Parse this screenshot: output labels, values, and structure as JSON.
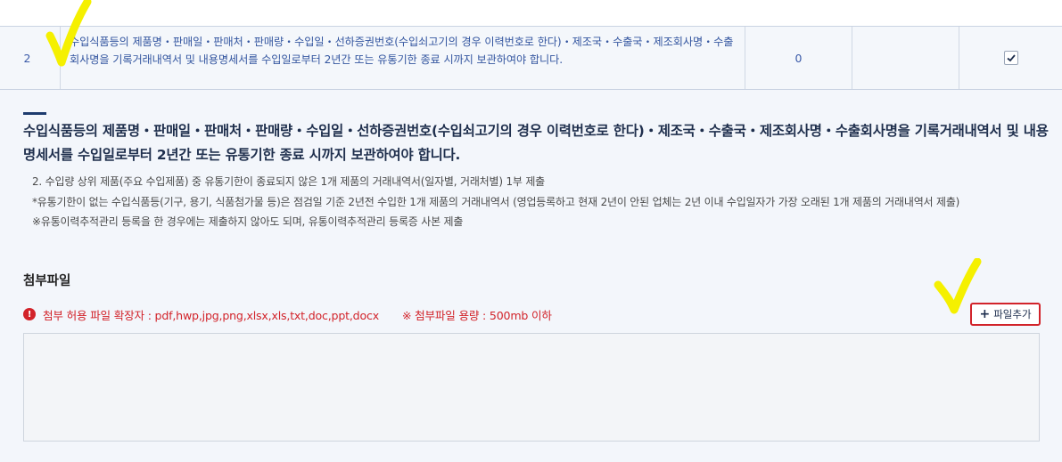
{
  "row": {
    "number": "2",
    "text": "수입식품등의 제품명・판매일・판매처・판매량・수입일・선하증권번호(수입쇠고기의 경우 이력번호로 한다)・제조국・수출국・제조회사명・수출회사명을 기록거래내역서 및 내용명세서를 수입일로부터 2년간 또는 유통기한 종료 시까지 보관하여야 합니다.",
    "count": "0",
    "checked": true
  },
  "detail": {
    "title": "수입식품등의 제품명・판매일・판매처・판매량・수입일・선하증권번호(수입쇠고기의 경우 이력번호로 한다)・제조국・수출국・제조회사명・수출회사명을 기록거래내역서 및 내용명세서를 수입일로부터 2년간 또는 유통기한 종료 시까지 보관하여야 합니다.",
    "notes": [
      "2. 수입량 상위 제품(주요 수입제품) 중 유통기한이 종료되지 않은 1개 제품의 거래내역서(일자별, 거래처별) 1부 제출",
      "*유통기한이 없는 수입식품등(기구, 용기, 식품첨가물 등)은 점검일 기준 2년전 수입한 1개 제품의 거래내역서 (영업등록하고 현재 2년이 안된 업체는 2년 이내 수입일자가 가장 오래된 1개 제품의 거래내역서 제출)",
      "※유통이력추적관리 등록을 한 경우에는 제출하지 않아도 되며, 유통이력추적관리 등록증 사본 제출"
    ]
  },
  "attachment": {
    "title": "첨부파일",
    "allowed_ext": "첨부 허용 파일 확장자 : pdf,hwp,jpg,png,xlsx,xls,txt,doc,ppt,docx",
    "size_limit": "※ 첨부파일 용량 : 500mb 이하",
    "add_button": "파일추가"
  },
  "colors": {
    "accent_red": "#d2232a",
    "link_blue": "#3456a0",
    "annotation_yellow": "#f5f000"
  },
  "icons": [
    "checkbox-checked-icon",
    "warning-icon",
    "plus-icon",
    "annotation-checkmark-icon"
  ]
}
